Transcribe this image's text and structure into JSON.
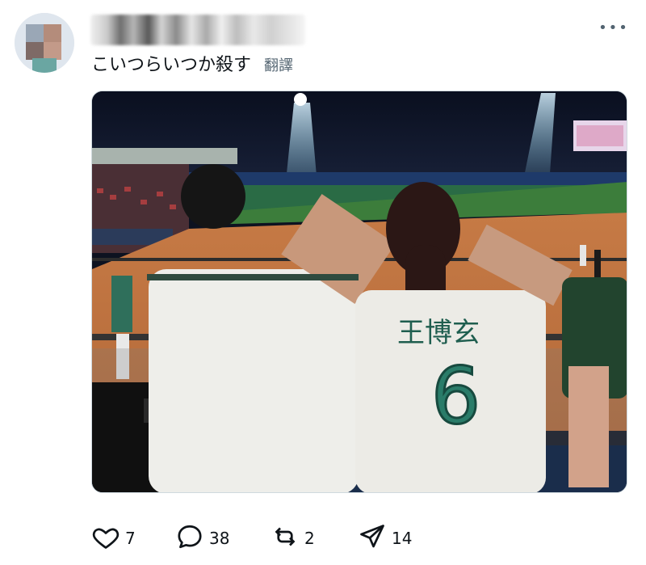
{
  "tweet": {
    "text": "こいつらいつか殺す",
    "translate_label": "翻譯",
    "more_label": "•••",
    "media": {
      "jersey_name": "王博玄",
      "jersey_number": "6"
    }
  },
  "actions": {
    "likes": "7",
    "replies": "38",
    "retweets": "2",
    "shares": "14"
  },
  "icons": [
    "heart-icon",
    "reply-icon",
    "retweet-icon",
    "share-icon",
    "more-icon"
  ]
}
